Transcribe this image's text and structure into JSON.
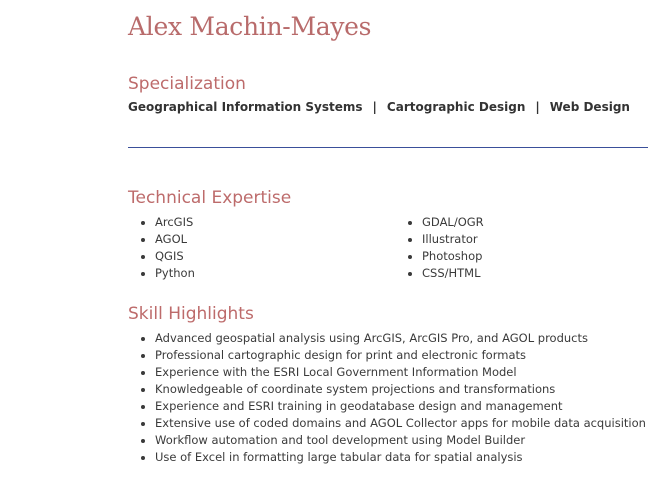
{
  "name": "Alex Machin-Mayes",
  "specialization": {
    "title": "Specialization",
    "items": [
      "Geographical Information Systems",
      "Cartographic Design",
      "Web Design"
    ],
    "separator": "|"
  },
  "technical_expertise": {
    "title": "Technical Expertise",
    "left": [
      "ArcGIS",
      "AGOL",
      "QGIS",
      "Python"
    ],
    "right": [
      "GDAL/OGR",
      "Illustrator",
      "Photoshop",
      "CSS/HTML"
    ]
  },
  "skill_highlights": {
    "title": "Skill Highlights",
    "items": [
      "Advanced geospatial analysis using ArcGIS, ArcGIS Pro, and AGOL products",
      "Professional cartographic design for print and electronic formats",
      "Experience with the ESRI Local Government Information Model",
      "Knowledgeable of coordinate system projections and transformations",
      "Experience and ESRI training in geodatabase design and management",
      "Extensive use of coded domains and AGOL Collector apps for mobile data acquisition",
      "Workflow automation and tool development using Model Builder",
      "Use of Excel in formatting large tabular data for spatial analysis"
    ]
  },
  "colors": {
    "heading": "#b86b6b",
    "divider": "#3a4f9a",
    "text": "#3a3a3a"
  }
}
